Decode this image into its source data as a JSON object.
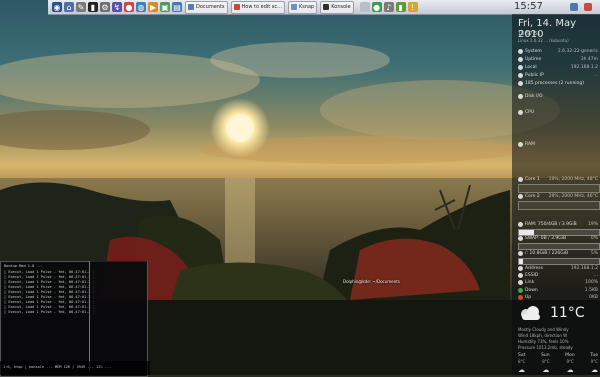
{
  "panel": {
    "tasks": [
      {
        "label": "Documents",
        "color": "#5a7bb5"
      },
      {
        "label": "How to edit sc...",
        "color": "#c9463d"
      },
      {
        "label": "Ksnap",
        "color": "#6b8fc7"
      },
      {
        "label": "Konsole",
        "color": "#303030"
      }
    ],
    "clock": "15:57"
  },
  "conky": {
    "date": "Fri, 14. May 2010",
    "time": "15:57:51",
    "kernel": "Linux 2.6.32 ... (kubuntu)",
    "sys": [
      {
        "k": "System",
        "v": "2.6.32-22-generic"
      },
      {
        "k": "Uptime",
        "v": "3h 47m"
      },
      {
        "k": "Local",
        "v": "192.168.1.2"
      },
      {
        "k": "Public IP",
        "v": "..."
      },
      {
        "k": "185 processes (2 running)",
        "v": ""
      }
    ],
    "disk_label": "Disk I/O",
    "cpu_label": "CPU",
    "mem_label": "RAM",
    "core1": {
      "label": "Core 1",
      "value": "19%, 2000 MHz, 48°C",
      "pct": 19
    },
    "core2": {
      "label": "Core 2",
      "value": "29%, 2000 MHz, 46°C",
      "pct": 29
    },
    "ram": {
      "label": "RAM: 750/4GB / 3.9GiB",
      "value": "19%",
      "pct": 19
    },
    "swap": {
      "label": "SWAP: 0B / 3.9GiB",
      "value": "0%",
      "pct": 0
    },
    "root": {
      "label": "/: 10.8GiB / 226GiB",
      "value": "5%",
      "pct": 5
    },
    "net": [
      {
        "k": "Address",
        "v": "192.168.1.2"
      },
      {
        "k": "ESSID",
        "v": "..."
      },
      {
        "k": "Link",
        "v": "100%"
      },
      {
        "k": "Down",
        "v": "1.5KB"
      },
      {
        "k": "Up",
        "v": "0KB"
      }
    ],
    "weather": {
      "temp": "11°C",
      "desc": "Mostly Cloudy and Windy",
      "wind": "Wind 18kph, direction W",
      "humidity": "Humidity 73%, feels 10%",
      "pressure": "Pressure 1013.2mb, steady",
      "days": [
        "Sat",
        "Sun",
        "Mon",
        "Tue"
      ],
      "lows": [
        "8°C",
        "8°C",
        "9°C",
        "9°C"
      ]
    }
  },
  "terminal": {
    "lines": [
      "Bootup Mod 1.0 ...",
      "[ Execut, Load 1 Pulse - fmt, 06.47:01.2 ]",
      "[ Execut, Load 1 Pulse - fmt, 06.47:01.2 ]",
      "[ Execut, Load 1 Pulse - fmt, 06.47:01.2 ]",
      "[ Execut, Load 1 Pulse - fmt, 06.47:01.2 ]",
      "[ Execut, Load 1 Pulse - fmt, 06.47:01.2 ]",
      "[ Execut, Load 1 Pulse - fmt, 06.47:01.2 ]",
      "[ Execut, Load 1 Pulse - fmt, 06.47:01.2 ]",
      "[ Execut, Load 1 Pulse - fmt, 06.47:01.2 ]",
      "[ Execut, Load 1 Pulse - fmt, 06.47:01.2 ]"
    ],
    "status": "1:0, htop | konsole ...  MEM 126 / 3949 ... 12% ..."
  },
  "tooltip": "Dolphin@kde: ~/Documents"
}
